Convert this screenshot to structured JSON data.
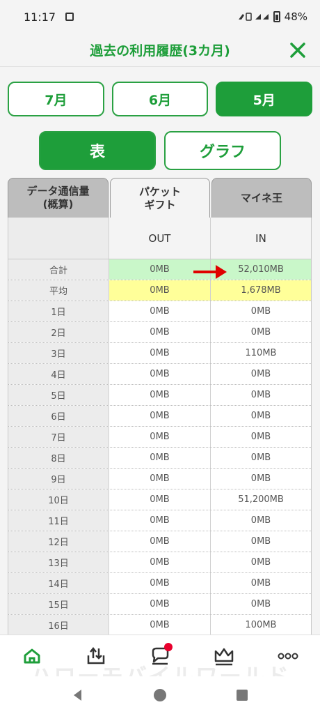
{
  "status_bar": {
    "time": "11:17",
    "battery": "48%"
  },
  "header": {
    "title": "過去の利用履歴(3カ月)"
  },
  "months": [
    {
      "label": "7月",
      "active": false
    },
    {
      "label": "6月",
      "active": false
    },
    {
      "label": "5月",
      "active": true
    }
  ],
  "view_toggle": {
    "table_label": "表",
    "graph_label": "グラフ"
  },
  "tabs": [
    {
      "label": "データ通信量\n(概算)"
    },
    {
      "label": "パケット\nギフト"
    },
    {
      "label": "マイネ王"
    }
  ],
  "table": {
    "head": {
      "out": "OUT",
      "in": "IN"
    },
    "total": {
      "label": "合計",
      "out": "0MB",
      "in": "52,010MB"
    },
    "avg": {
      "label": "平均",
      "out": "0MB",
      "in": "1,678MB"
    },
    "rows": [
      {
        "day": "1日",
        "out": "0MB",
        "in": "0MB"
      },
      {
        "day": "2日",
        "out": "0MB",
        "in": "0MB"
      },
      {
        "day": "3日",
        "out": "0MB",
        "in": "110MB"
      },
      {
        "day": "4日",
        "out": "0MB",
        "in": "0MB"
      },
      {
        "day": "5日",
        "out": "0MB",
        "in": "0MB"
      },
      {
        "day": "6日",
        "out": "0MB",
        "in": "0MB"
      },
      {
        "day": "7日",
        "out": "0MB",
        "in": "0MB"
      },
      {
        "day": "8日",
        "out": "0MB",
        "in": "0MB"
      },
      {
        "day": "9日",
        "out": "0MB",
        "in": "0MB"
      },
      {
        "day": "10日",
        "out": "0MB",
        "in": "51,200MB"
      },
      {
        "day": "11日",
        "out": "0MB",
        "in": "0MB"
      },
      {
        "day": "12日",
        "out": "0MB",
        "in": "0MB"
      },
      {
        "day": "13日",
        "out": "0MB",
        "in": "0MB"
      },
      {
        "day": "14日",
        "out": "0MB",
        "in": "0MB"
      },
      {
        "day": "15日",
        "out": "0MB",
        "in": "0MB"
      },
      {
        "day": "16日",
        "out": "0MB",
        "in": "100MB"
      }
    ]
  },
  "bottom_nav": {
    "items": [
      {
        "icon": "home-icon"
      },
      {
        "icon": "data-tray-icon"
      },
      {
        "icon": "chat-icon",
        "badge": true
      },
      {
        "icon": "crown-icon"
      },
      {
        "icon": "more-icon"
      }
    ]
  },
  "watermark": "ハローモバイルワールド",
  "colors": {
    "accent": "#1e9e3a",
    "total_bg": "#c9f7c9",
    "avg_bg": "#ffff99",
    "badge": "#e8002d",
    "arrow": "#e00000"
  }
}
